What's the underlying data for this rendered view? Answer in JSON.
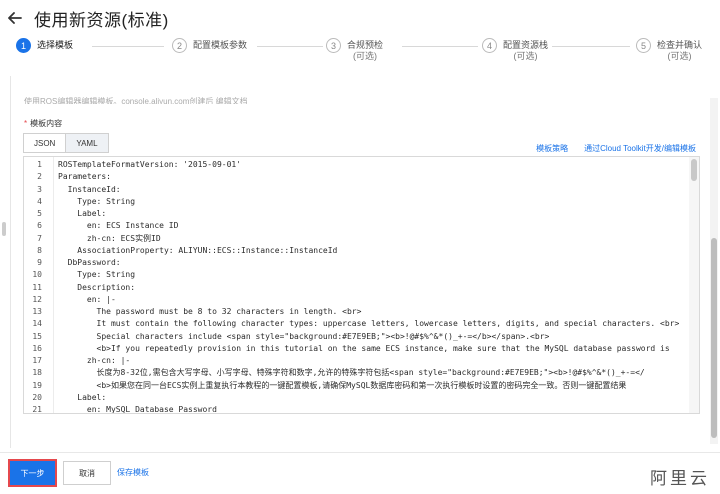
{
  "header": {
    "title": "使用新资源(标准)"
  },
  "steps": [
    {
      "num": "1",
      "label": "选择模板",
      "sub": "",
      "active": true
    },
    {
      "num": "2",
      "label": "配置模板参数",
      "sub": "",
      "active": false
    },
    {
      "num": "3",
      "label": "合规预检",
      "sub": "(可选)",
      "active": false
    },
    {
      "num": "4",
      "label": "配置资源栈",
      "sub": "(可选)",
      "active": false
    },
    {
      "num": "5",
      "label": "检查并确认",
      "sub": "(可选)",
      "active": false
    }
  ],
  "form": {
    "cut_text": "使用ROS编辑器编辑模板。console.aliyun.com创建后 编辑文档",
    "required_mark": "*",
    "label": "模板内容",
    "tabs": [
      "JSON",
      "YAML"
    ],
    "active_tab": "YAML",
    "links": [
      "模板策略",
      "通过Cloud Toolkit开发/编辑模板"
    ]
  },
  "editor": {
    "lines": [
      {
        "n": "1",
        "text": "ROSTemplateFormatVersion: '2015-09-01'"
      },
      {
        "n": "2",
        "text": "Parameters:"
      },
      {
        "n": "3",
        "text": "  InstanceId:"
      },
      {
        "n": "4",
        "text": "    Type: String"
      },
      {
        "n": "5",
        "text": "    Label:"
      },
      {
        "n": "6",
        "text": "      en: ECS Instance ID"
      },
      {
        "n": "7",
        "text": "      zh-cn: ECS实例ID"
      },
      {
        "n": "8",
        "text": "    AssociationProperty: ALIYUN::ECS::Instance::InstanceId"
      },
      {
        "n": "9",
        "text": "  DbPassword:"
      },
      {
        "n": "10",
        "text": "    Type: String"
      },
      {
        "n": "11",
        "text": "    Description:"
      },
      {
        "n": "12",
        "text": "      en: |-"
      },
      {
        "n": "13",
        "text": "        The password must be 8 to 32 characters in length. <br>"
      },
      {
        "n": "14",
        "text": "        It must contain the following character types: uppercase letters, lowercase letters, digits, and special characters. <br>"
      },
      {
        "n": "15",
        "text": "        Special characters include <span style=\"background:#E7E9EB;\"><b>!@#$%^&*()_+-=</b></span>.<br>"
      },
      {
        "n": "16",
        "text": "        <b>If you repeatedly provision in this tutorial on the same ECS instance, make sure that the MySQL database password is"
      },
      {
        "n": "17",
        "text": "      zh-cn: |-"
      },
      {
        "n": "18",
        "text": "        长度为8-32位,需包含大写字母、小写字母、特殊字符和数字,允许的特殊字符包括<span style=\"background:#E7E9EB;\"><b>!@#$%^&*()_+-=</"
      },
      {
        "n": "19",
        "text": "        <b>如果您在同一台ECS实例上重复执行本教程的一键配置模板,请确保MySQL数据库密码和第一次执行模板时设置的密码完全一致。否则一键配置结果"
      },
      {
        "n": "20",
        "text": "    Label:"
      },
      {
        "n": "21",
        "text": "      en: MySQL Database Password"
      }
    ]
  },
  "footer": {
    "next_label": "下一步",
    "cancel_label": "取消",
    "save_label": "保存模板"
  },
  "watermark": "阿里云",
  "colors": {
    "primary": "#1a73e8",
    "highlight_border": "#e5484d"
  }
}
